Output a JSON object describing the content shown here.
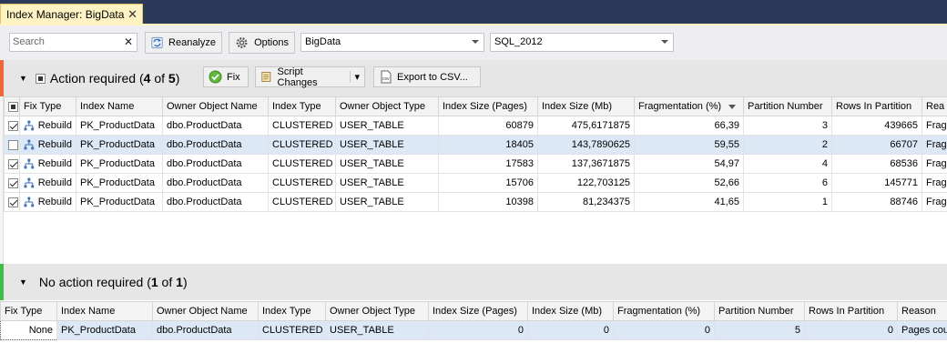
{
  "tab": {
    "title": "Index Manager: BigData",
    "close": "✕"
  },
  "toolbar": {
    "search_placeholder": "Search",
    "search_clear": "✕",
    "reanalyze_label": "Reanalyze",
    "options_label": "Options",
    "database_value": "BigData",
    "server_value": "SQL_2012"
  },
  "group1": {
    "title_prefix": "Action required (",
    "count": "4",
    "of": " of ",
    "total": "5",
    "title_suffix": ")",
    "fix_label": "Fix",
    "script_label": "Script Changes",
    "export_label": "Export to CSV...",
    "accent_color": "#f0673c",
    "columns": [
      "Fix Type",
      "Index Name",
      "Owner Object Name",
      "Index Type",
      "Owner Object Type",
      "Index Size (Pages)",
      "Index Size (Mb)",
      "Fragmentation (%)",
      "Partition Number",
      "Rows In Partition",
      "Rea"
    ],
    "rows": [
      {
        "checked": true,
        "fix": "Rebuild",
        "index": "PK_ProductData",
        "owner": "dbo.ProductData",
        "itype": "CLUSTERED",
        "otype": "USER_TABLE",
        "pages": "60879",
        "mb": "475,6171875",
        "frag": "66,39",
        "part": "3",
        "rows": "439665",
        "reason": "Frag"
      },
      {
        "checked": false,
        "fix": "Rebuild",
        "index": "PK_ProductData",
        "owner": "dbo.ProductData",
        "itype": "CLUSTERED",
        "otype": "USER_TABLE",
        "pages": "18405",
        "mb": "143,7890625",
        "frag": "59,55",
        "part": "2",
        "rows": "66707",
        "reason": "Frag"
      },
      {
        "checked": true,
        "fix": "Rebuild",
        "index": "PK_ProductData",
        "owner": "dbo.ProductData",
        "itype": "CLUSTERED",
        "otype": "USER_TABLE",
        "pages": "17583",
        "mb": "137,3671875",
        "frag": "54,97",
        "part": "4",
        "rows": "68536",
        "reason": "Frag"
      },
      {
        "checked": true,
        "fix": "Rebuild",
        "index": "PK_ProductData",
        "owner": "dbo.ProductData",
        "itype": "CLUSTERED",
        "otype": "USER_TABLE",
        "pages": "15706",
        "mb": "122,703125",
        "frag": "52,66",
        "part": "6",
        "rows": "145771",
        "reason": "Frag"
      },
      {
        "checked": true,
        "fix": "Rebuild",
        "index": "PK_ProductData",
        "owner": "dbo.ProductData",
        "itype": "CLUSTERED",
        "otype": "USER_TABLE",
        "pages": "10398",
        "mb": "81,234375",
        "frag": "41,65",
        "part": "1",
        "rows": "88746",
        "reason": "Frag"
      }
    ]
  },
  "group2": {
    "title_prefix": "No action required (",
    "count": "1",
    "of": " of ",
    "total": "1",
    "title_suffix": ")",
    "accent_color": "#3fbf4a",
    "columns": [
      "Fix Type",
      "Index Name",
      "Owner Object Name",
      "Index Type",
      "Owner Object Type",
      "Index Size (Pages)",
      "Index Size (Mb)",
      "Fragmentation (%)",
      "Partition Number",
      "Rows In Partition",
      "Reason"
    ],
    "rows": [
      {
        "fix": "None",
        "index": "PK_ProductData",
        "owner": "dbo.ProductData",
        "itype": "CLUSTERED",
        "otype": "USER_TABLE",
        "pages": "0",
        "mb": "0",
        "frag": "0",
        "part": "5",
        "rows": "0",
        "reason": "Pages coun"
      }
    ]
  }
}
